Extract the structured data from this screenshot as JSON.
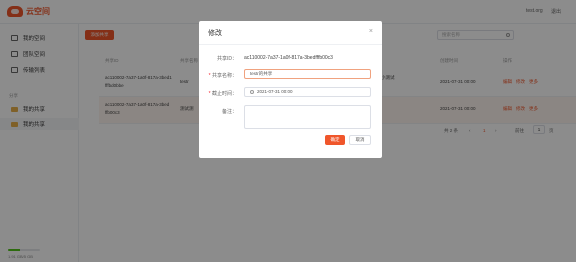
{
  "app": {
    "name": "云空间"
  },
  "topbar": {
    "user": "test.org",
    "action": "退出"
  },
  "sidebar": {
    "items": [
      {
        "label": "我的空间",
        "icon": "drive-icon"
      },
      {
        "label": "团队空间",
        "icon": "team-icon"
      },
      {
        "label": "传输列表",
        "icon": "transfer-icon"
      }
    ],
    "section_label": "分享",
    "share_items": [
      {
        "label": "我的共享",
        "icon": "folder-icon"
      },
      {
        "label": "我的共享",
        "icon": "folder-icon"
      }
    ],
    "storage": {
      "text": "1.91 GB/5 GB",
      "used_fraction": 0.38
    }
  },
  "main": {
    "new_button": "添加共享",
    "search_placeholder": "搜索名称",
    "columns": [
      "共享ID",
      "共享名称",
      "截止时间",
      "备注",
      "创建时间",
      "操作"
    ],
    "rows": [
      {
        "id_line1": "ac110002-7a37-1a0f-817a-3bed1",
        "id_line2": "fffbd0bbe",
        "name": "testr",
        "remark_line1": "共享小测试",
        "remark_line2": "很好",
        "created": "2021-07-31 00:00",
        "ops": [
          "编辑",
          "修改",
          "更多"
        ]
      },
      {
        "id_line1": "ac110002-7a37-1a0f-817a-3bed",
        "id_line2": "ffb00c3",
        "name": "测试测",
        "remark_line1": "",
        "remark_line2": "",
        "created": "2021-07-31 00:00",
        "ops": [
          "编辑",
          "修改",
          "更多"
        ]
      }
    ],
    "pager": {
      "total": "共 2 条",
      "page": "1",
      "goto": "前往",
      "unit": "页"
    }
  },
  "modal": {
    "title": "修改",
    "close_glyph": "×",
    "fields": {
      "share_id_label": "共享ID：",
      "share_id_value": "ac110002-7a37-1a0f-817a-3bedfffb00c3",
      "name_label": "共享名称：",
      "name_value": "testr的共享",
      "deadline_label": "截止时间：",
      "deadline_value": "2021-07-31 00:00",
      "remark_label": "备注："
    },
    "ok_label": "确定",
    "cancel_label": "取消"
  }
}
